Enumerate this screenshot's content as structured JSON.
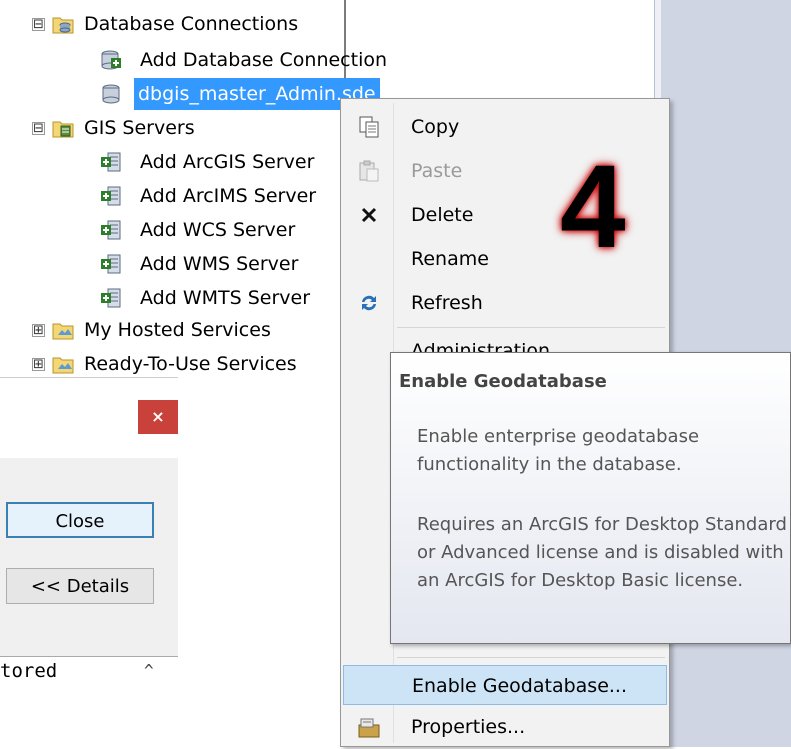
{
  "tree": {
    "db_connections": "Database Connections",
    "add_db_connection": "Add Database Connection",
    "selected_connection": "dbgis_master_Admin.sde",
    "gis_servers": "GIS Servers",
    "servers": [
      "Add ArcGIS Server",
      "Add ArcIMS Server",
      "Add WCS Server",
      "Add WMS Server",
      "Add WMTS Server"
    ],
    "my_hosted": "My Hosted Services",
    "ready_to_use": "Ready-To-Use Services",
    "expand_minus": "⊟",
    "expand_plus": "⊞"
  },
  "dialog": {
    "close_x": "×",
    "close_label": "Close",
    "details_label": "<< Details",
    "log_text": "tored",
    "caret": "^"
  },
  "context_menu": {
    "copy": "Copy",
    "paste": "Paste",
    "delete": "Delete",
    "rename": "Rename",
    "refresh": "Refresh",
    "administration": "Administration",
    "enable_geodatabase": "Enable Geodatabase...",
    "properties": "Properties..."
  },
  "tooltip": {
    "title": "Enable Geodatabase",
    "para1": "Enable enterprise geodatabase functionality in the database.",
    "para2": "Requires an ArcGIS for Desktop Standard or Advanced license and is disabled with an ArcGIS for Desktop Basic license."
  },
  "annotation": {
    "step_number": "4"
  },
  "colors": {
    "selection": "#3399ff",
    "menu_highlight": "#cde4f7",
    "close_red": "#c8413a"
  },
  "icons": {
    "db_folder": "database-folder-icon",
    "add_conn": "add-connection-icon",
    "db": "database-icon",
    "server_folder": "server-folder-icon",
    "add_server": "add-server-icon",
    "folder": "folder-icon",
    "copy": "copy-icon",
    "paste": "paste-icon",
    "delete": "delete-icon",
    "refresh": "refresh-icon",
    "properties": "properties-icon"
  }
}
